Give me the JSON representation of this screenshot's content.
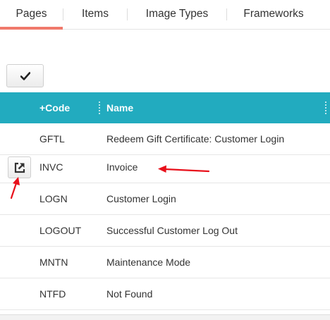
{
  "tabs": [
    {
      "label": "Pages",
      "active": true
    },
    {
      "label": "Items",
      "active": false
    },
    {
      "label": "Image Types",
      "active": false
    },
    {
      "label": "Frameworks",
      "active": false
    }
  ],
  "toolbar": {
    "confirm_icon": "checkmark-icon"
  },
  "grid": {
    "columns": {
      "code": "+Code",
      "name": "Name"
    },
    "rows": [
      {
        "code": "GFTL",
        "name": "Redeem Gift Certificate: Customer Login"
      },
      {
        "code": "INVC",
        "name": "Invoice",
        "action_icon": "open-external-icon"
      },
      {
        "code": "LOGN",
        "name": "Customer Login"
      },
      {
        "code": "LOGOUT",
        "name": "Successful Customer Log Out"
      },
      {
        "code": "MNTN",
        "name": "Maintenance Mode"
      },
      {
        "code": "NTFD",
        "name": "Not Found"
      }
    ]
  },
  "colors": {
    "accent_tab": "#f0796b",
    "header_bg": "#22abbf",
    "annotation_arrow": "#e8101b"
  }
}
